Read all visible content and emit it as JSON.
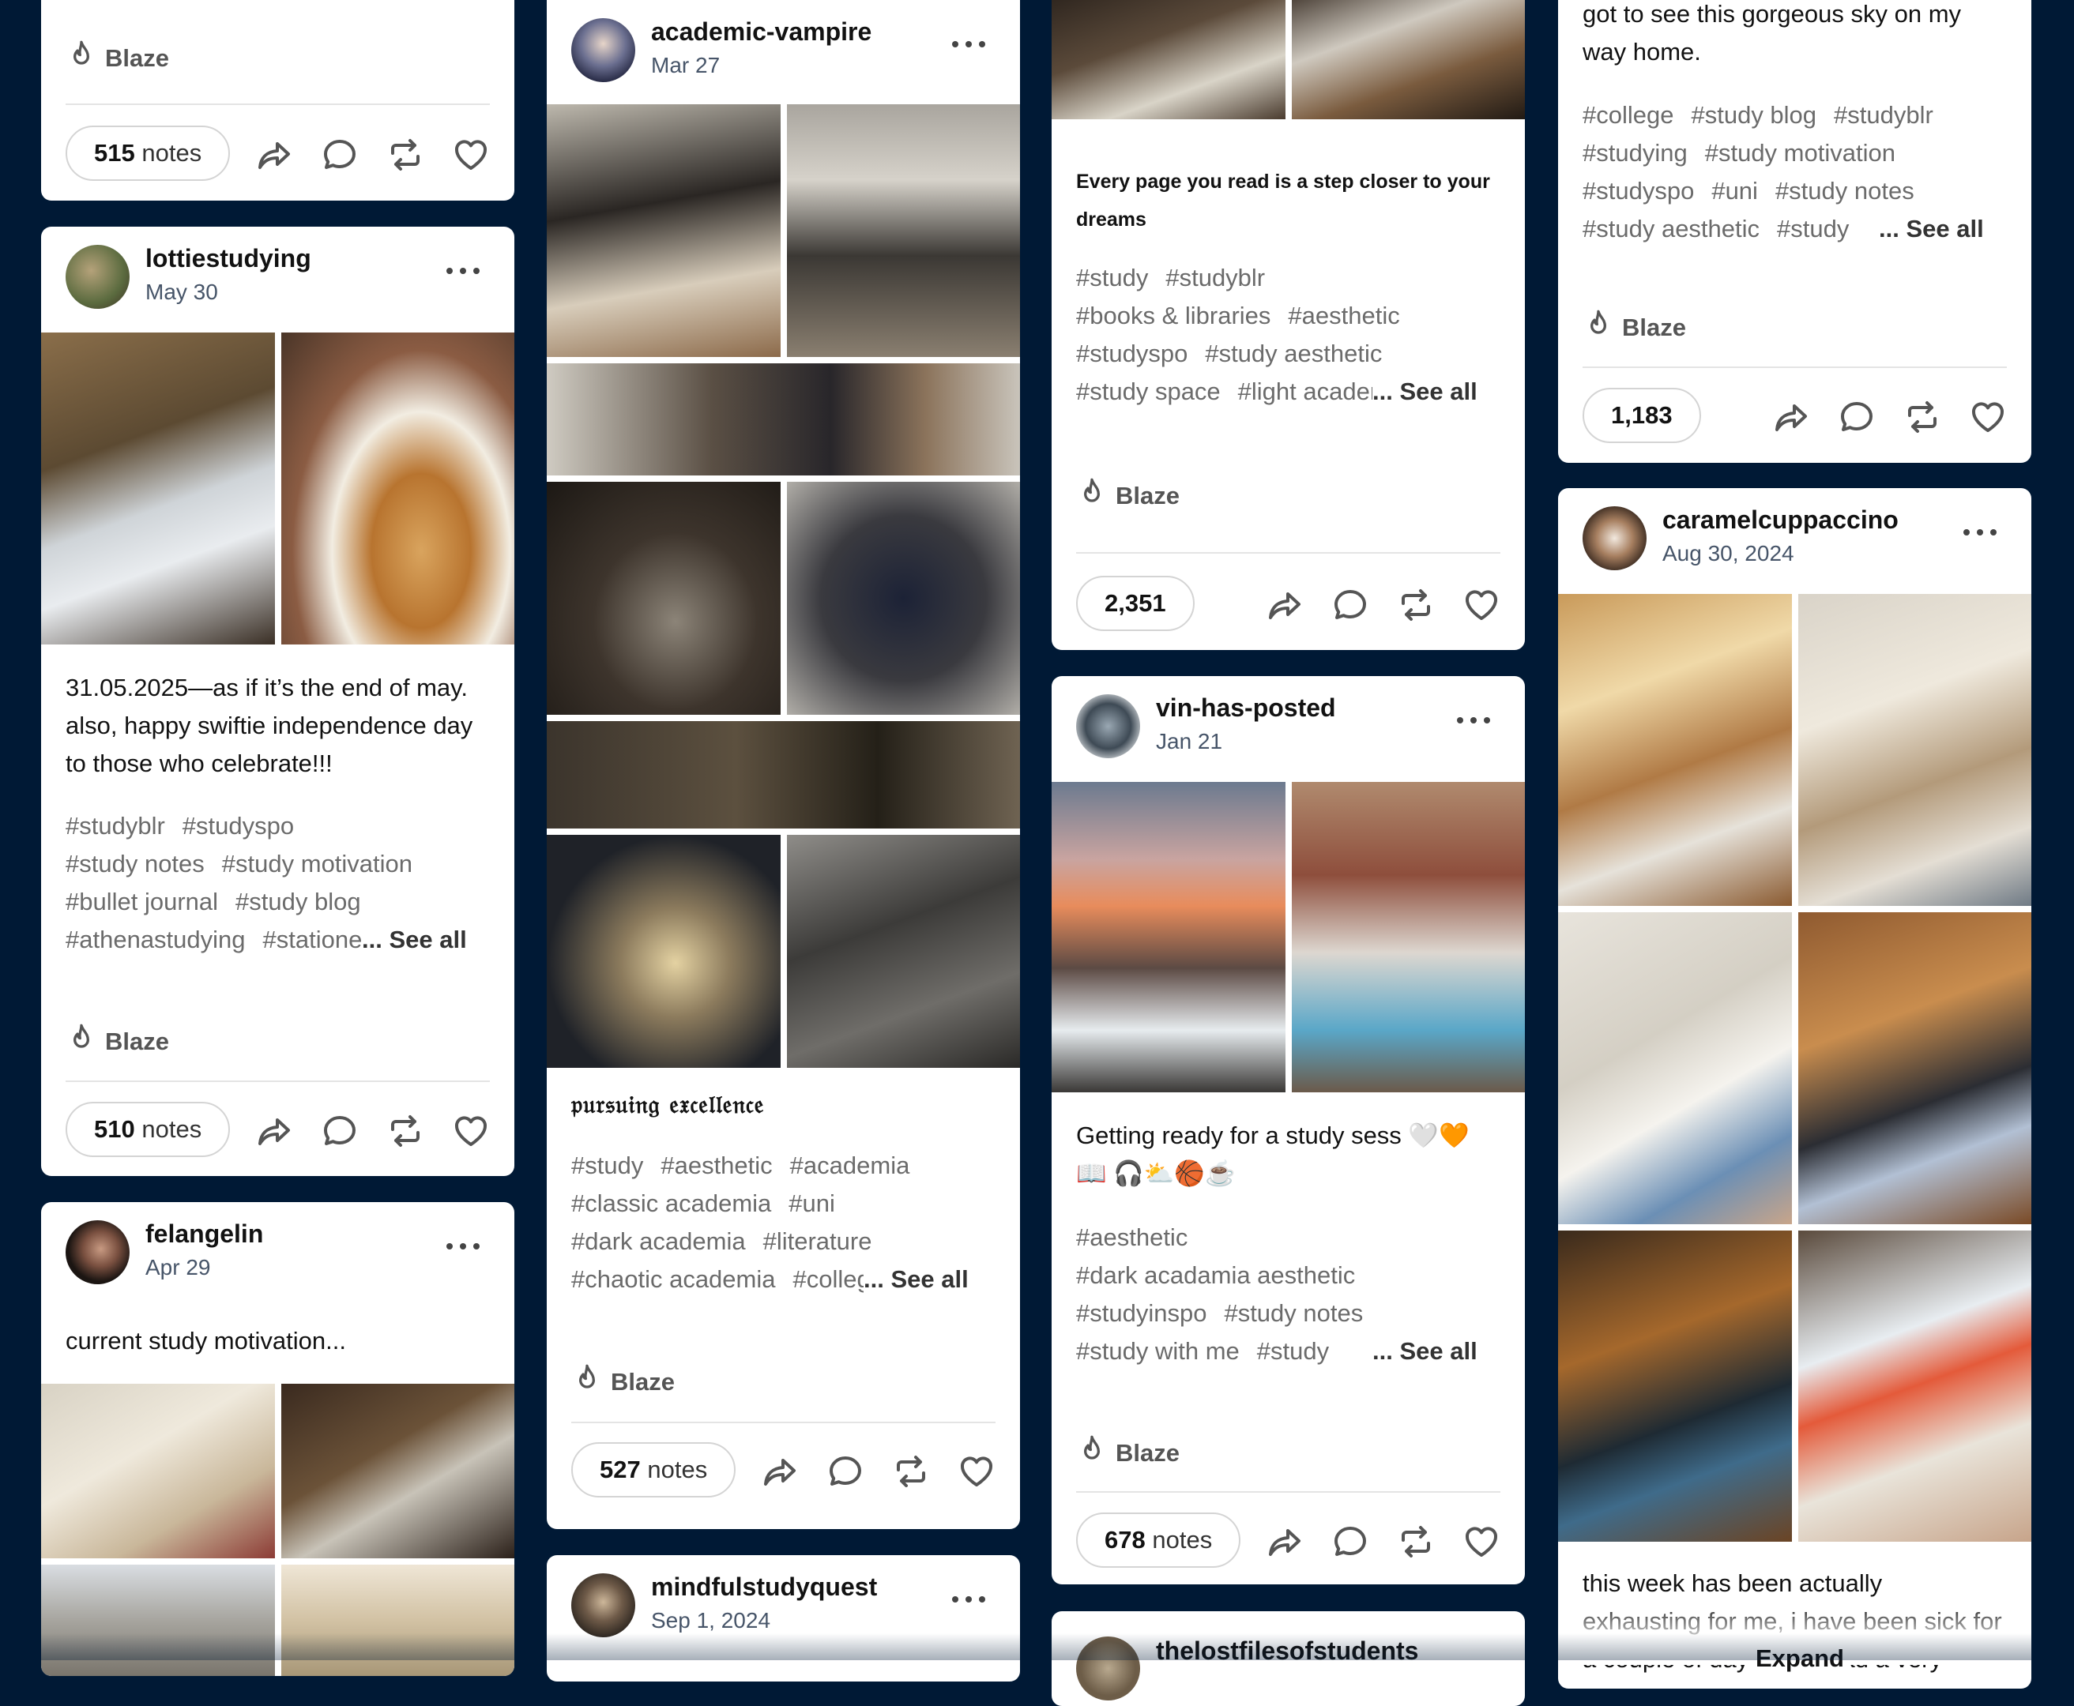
{
  "colors": {
    "background": "#001935",
    "card": "#ffffff",
    "username": "#121212",
    "date": "#475569",
    "tag": "#6b6b6b"
  },
  "common": {
    "blaze_label": "Blaze",
    "notes_suffix": "notes",
    "see_all": "... See all",
    "expand": "Expand"
  },
  "col1": {
    "card_a": {
      "notes_count": "515"
    },
    "card_b": {
      "username": "lottiestudying",
      "date": "May 30",
      "caption": "31.05.2025—as if it’s the end of may. also, happy swiftie independence day to those who celebrate!!!",
      "tag_rows": [
        [
          "#studyblr",
          "#studyspo"
        ],
        [
          "#study notes",
          "#study motivation"
        ],
        [
          "#bullet journal",
          "#study blog"
        ],
        [
          "#athenastudying",
          "#stationery"
        ]
      ],
      "notes_count": "510"
    },
    "card_c": {
      "username": "felangelin",
      "date": "Apr 29",
      "caption": "current study motivation..."
    }
  },
  "col2": {
    "card_a": {
      "username": "academic-vampire",
      "date": "Mar 27",
      "quote": "𝔭𝔲𝔯𝔰𝔲𝔦𝔫𝔤 𝔢𝔵𝔠𝔢𝔩𝔩𝔢𝔫𝔠𝔢",
      "tag_rows": [
        [
          "#study",
          "#aesthetic",
          "#academia"
        ],
        [
          "#classic academia",
          "#uni"
        ],
        [
          "#dark academia",
          "#literature"
        ],
        [
          "#chaotic academia",
          "#college"
        ]
      ],
      "notes_count": "527"
    },
    "card_b": {
      "username": "mindfulstudyquest",
      "date": "Sep 1, 2024"
    }
  },
  "col3": {
    "card_a": {
      "quote": "Every page you read is a step closer to your dreams",
      "tag_rows": [
        [
          "#study",
          "#studyblr"
        ],
        [
          "#books & libraries",
          "#aesthetic"
        ],
        [
          "#studyspo",
          "#study aesthetic"
        ],
        [
          "#study space",
          "#light academia"
        ]
      ],
      "notes_count": "2,351"
    },
    "card_b": {
      "username": "vin-has-posted",
      "date": "Jan 21",
      "caption": "Getting ready for a study sess 🤍🧡📖 🎧⛅🏀☕",
      "tag_rows": [
        [
          "#aesthetic"
        ],
        [
          "#dark acadamia aesthetic"
        ],
        [
          "#studyinspo",
          "#study notes"
        ],
        [
          "#study with me",
          "#study"
        ]
      ],
      "notes_count": "678"
    },
    "card_c": {
      "username": "thelostfilesofstudents"
    }
  },
  "col4": {
    "card_a": {
      "caption": "got to see this gorgeous sky on my way home.",
      "tag_rows": [
        [
          "#college",
          "#study blog",
          "#studyblr"
        ],
        [
          "#studying",
          "#study motivation"
        ],
        [
          "#studyspo",
          "#uni",
          "#study notes"
        ],
        [
          "#study aesthetic",
          "#study"
        ]
      ],
      "notes_count": "1,183"
    },
    "card_b": {
      "username": "caramelcuppaccino",
      "date": "Aug 30, 2024",
      "caption": "this week has been actually exhausting for me, i have been sick for a couple of days and i had a very"
    }
  }
}
